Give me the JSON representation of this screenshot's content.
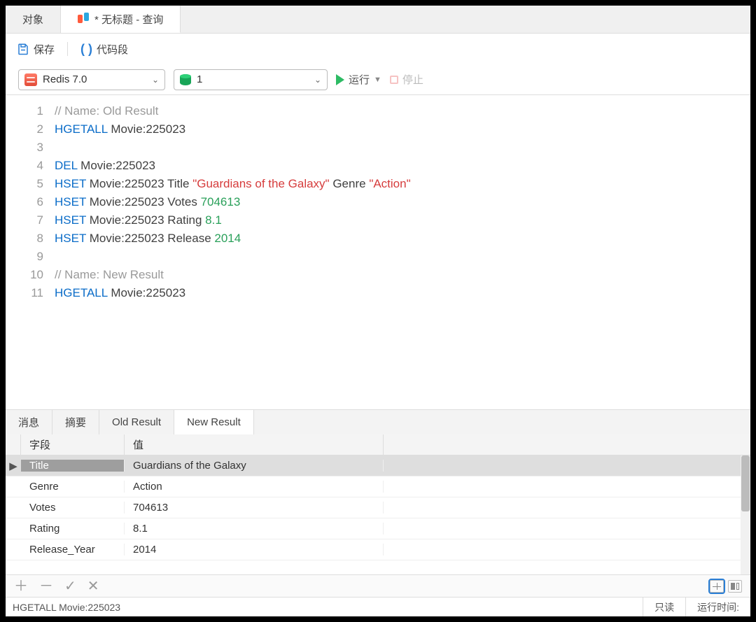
{
  "top_tabs": [
    {
      "label": "对象"
    },
    {
      "label": "* 无标题 - 查询"
    }
  ],
  "toolbar": {
    "save": "保存",
    "snippet": "代码段"
  },
  "conn": {
    "redis": "Redis 7.0",
    "db": "1",
    "run": "运行",
    "stop": "停止"
  },
  "code": {
    "lines": [
      {
        "n": "1",
        "tokens": [
          [
            "cmt",
            "// Name: Old Result"
          ]
        ]
      },
      {
        "n": "2",
        "tokens": [
          [
            "kw",
            "HGETALL"
          ],
          [
            "",
            " Movie:225023"
          ]
        ]
      },
      {
        "n": "3",
        "tokens": [
          [
            "",
            ""
          ]
        ]
      },
      {
        "n": "4",
        "tokens": [
          [
            "kw",
            "DEL"
          ],
          [
            "",
            " Movie:225023"
          ]
        ]
      },
      {
        "n": "5",
        "tokens": [
          [
            "kw",
            "HSET"
          ],
          [
            "",
            " Movie:225023 Title "
          ],
          [
            "str",
            "\"Guardians of the Galaxy\""
          ],
          [
            "",
            " Genre "
          ],
          [
            "str",
            "\"Action\""
          ]
        ]
      },
      {
        "n": "6",
        "tokens": [
          [
            "kw",
            "HSET"
          ],
          [
            "",
            " Movie:225023 Votes "
          ],
          [
            "num",
            "704613"
          ]
        ]
      },
      {
        "n": "7",
        "tokens": [
          [
            "kw",
            "HSET"
          ],
          [
            "",
            " Movie:225023 Rating "
          ],
          [
            "num",
            "8.1"
          ]
        ]
      },
      {
        "n": "8",
        "tokens": [
          [
            "kw",
            "HSET"
          ],
          [
            "",
            " Movie:225023 Release "
          ],
          [
            "num",
            "2014"
          ]
        ]
      },
      {
        "n": "9",
        "tokens": [
          [
            "",
            ""
          ]
        ]
      },
      {
        "n": "10",
        "tokens": [
          [
            "cmt",
            "// Name: New Result"
          ]
        ]
      },
      {
        "n": "11",
        "tokens": [
          [
            "kw",
            "HGETALL"
          ],
          [
            "",
            " Movie:225023"
          ]
        ]
      }
    ]
  },
  "result_tabs": [
    "消息",
    "摘要",
    "Old Result",
    "New Result"
  ],
  "result_tabs_active": 3,
  "grid": {
    "headers": [
      "字段",
      "值"
    ],
    "rows": [
      {
        "k": "Title",
        "v": "Guardians of the Galaxy"
      },
      {
        "k": "Genre",
        "v": "Action"
      },
      {
        "k": "Votes",
        "v": "704613"
      },
      {
        "k": "Rating",
        "v": "8.1"
      },
      {
        "k": "Release_Year",
        "v": "2014"
      }
    ],
    "selected": 0
  },
  "status": {
    "query": "HGETALL Movie:225023",
    "readonly": "只读",
    "runtime_label": "运行时间:"
  }
}
